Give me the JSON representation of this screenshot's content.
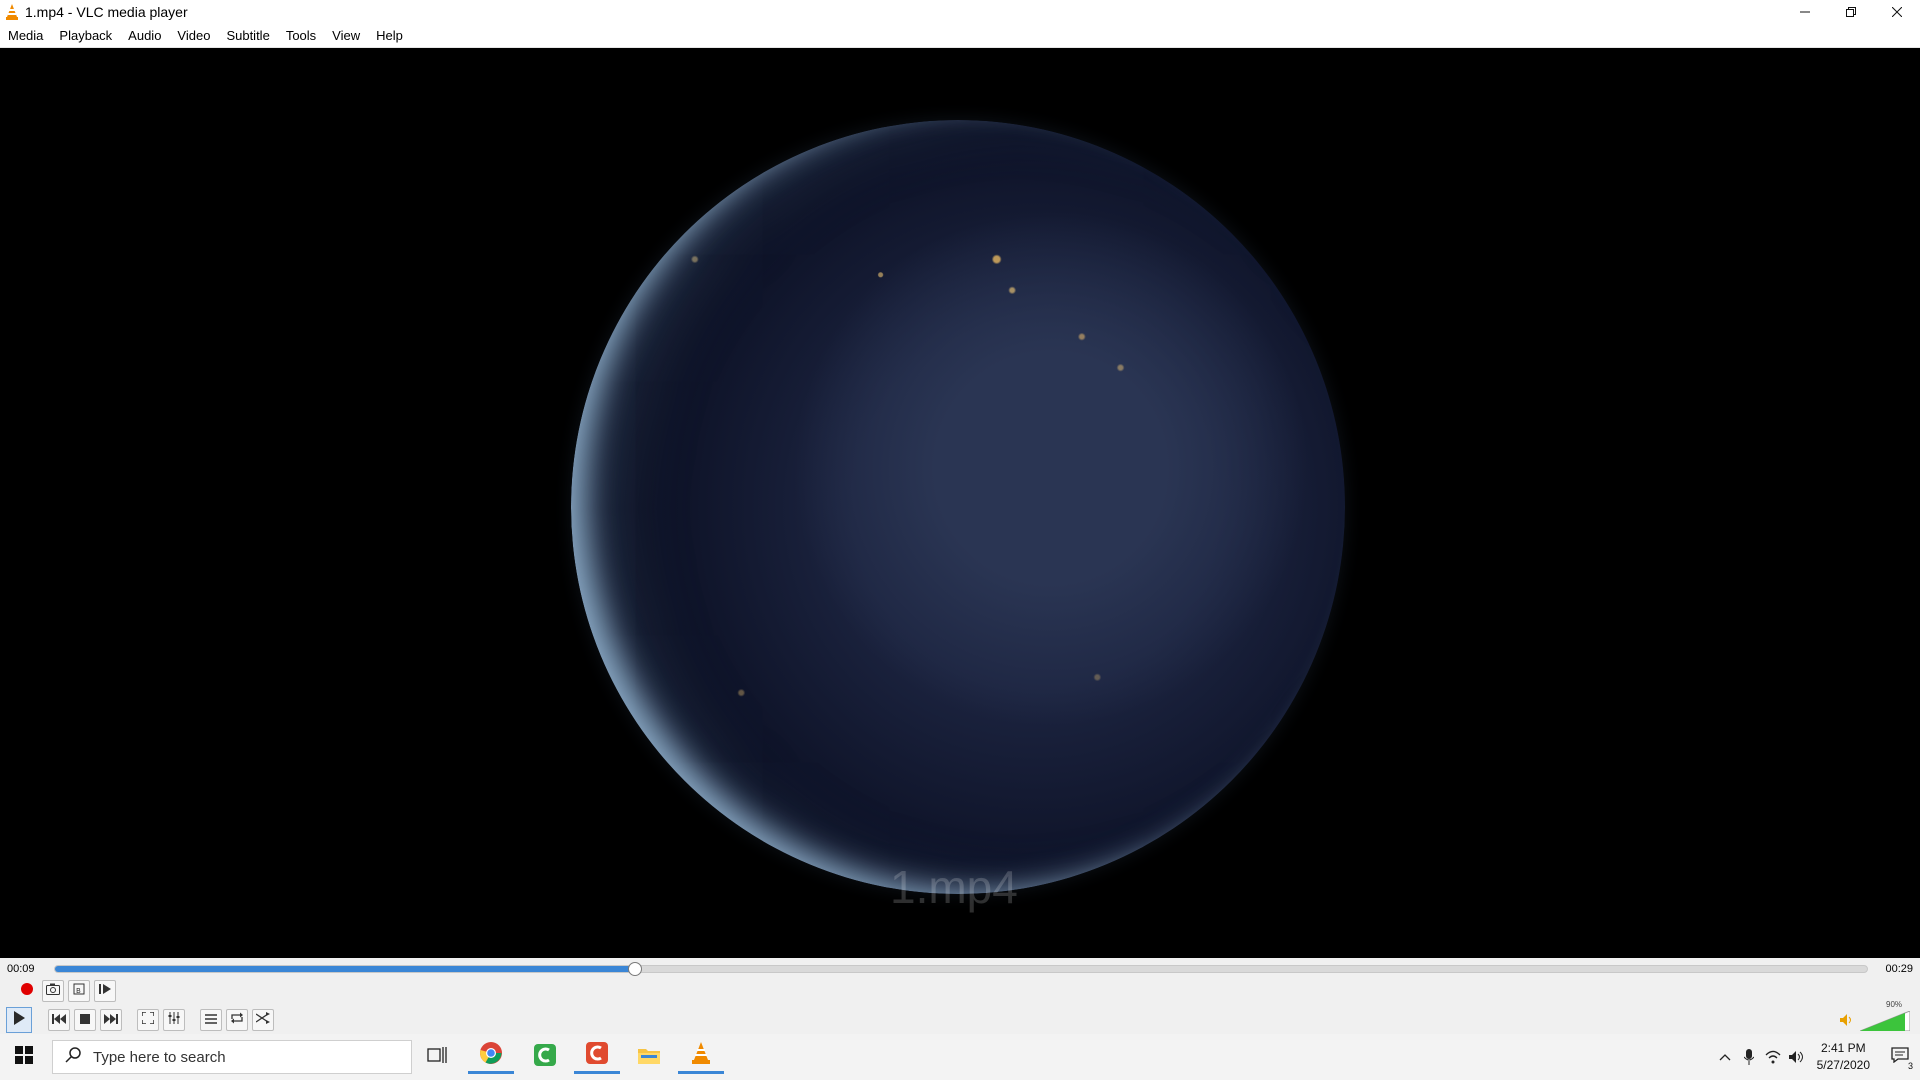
{
  "window": {
    "title": "1.mp4 - VLC media player",
    "controls": [
      "minimize",
      "restore",
      "close"
    ]
  },
  "menu": [
    "Media",
    "Playback",
    "Audio",
    "Video",
    "Subtitle",
    "Tools",
    "View",
    "Help"
  ],
  "video": {
    "watermark": "1.mp4"
  },
  "player": {
    "time_elapsed": "00:09",
    "time_total": "00:29",
    "progress": 0.32,
    "volume_label": "90%",
    "volume": 0.9,
    "top_row_icons": [
      "record-icon",
      "snapshot-icon",
      "loop-ab-icon",
      "frame-step-icon"
    ],
    "bottom_row_icons": [
      "play-icon",
      "previous-icon",
      "stop-icon",
      "next-icon",
      "fullscreen-icon",
      "extended-settings-icon",
      "playlist-icon",
      "loop-icon",
      "shuffle-icon"
    ],
    "accent": "#3a86d6"
  },
  "taskbar": {
    "search_placeholder": "Type here to search",
    "apps": [
      "task-view-icon",
      "chrome-icon",
      "camtasia-green-icon",
      "camtasia-red-icon",
      "file-explorer-icon",
      "vlc-icon"
    ],
    "time": "2:41 PM",
    "date": "5/27/2020",
    "notification_count": "3"
  }
}
